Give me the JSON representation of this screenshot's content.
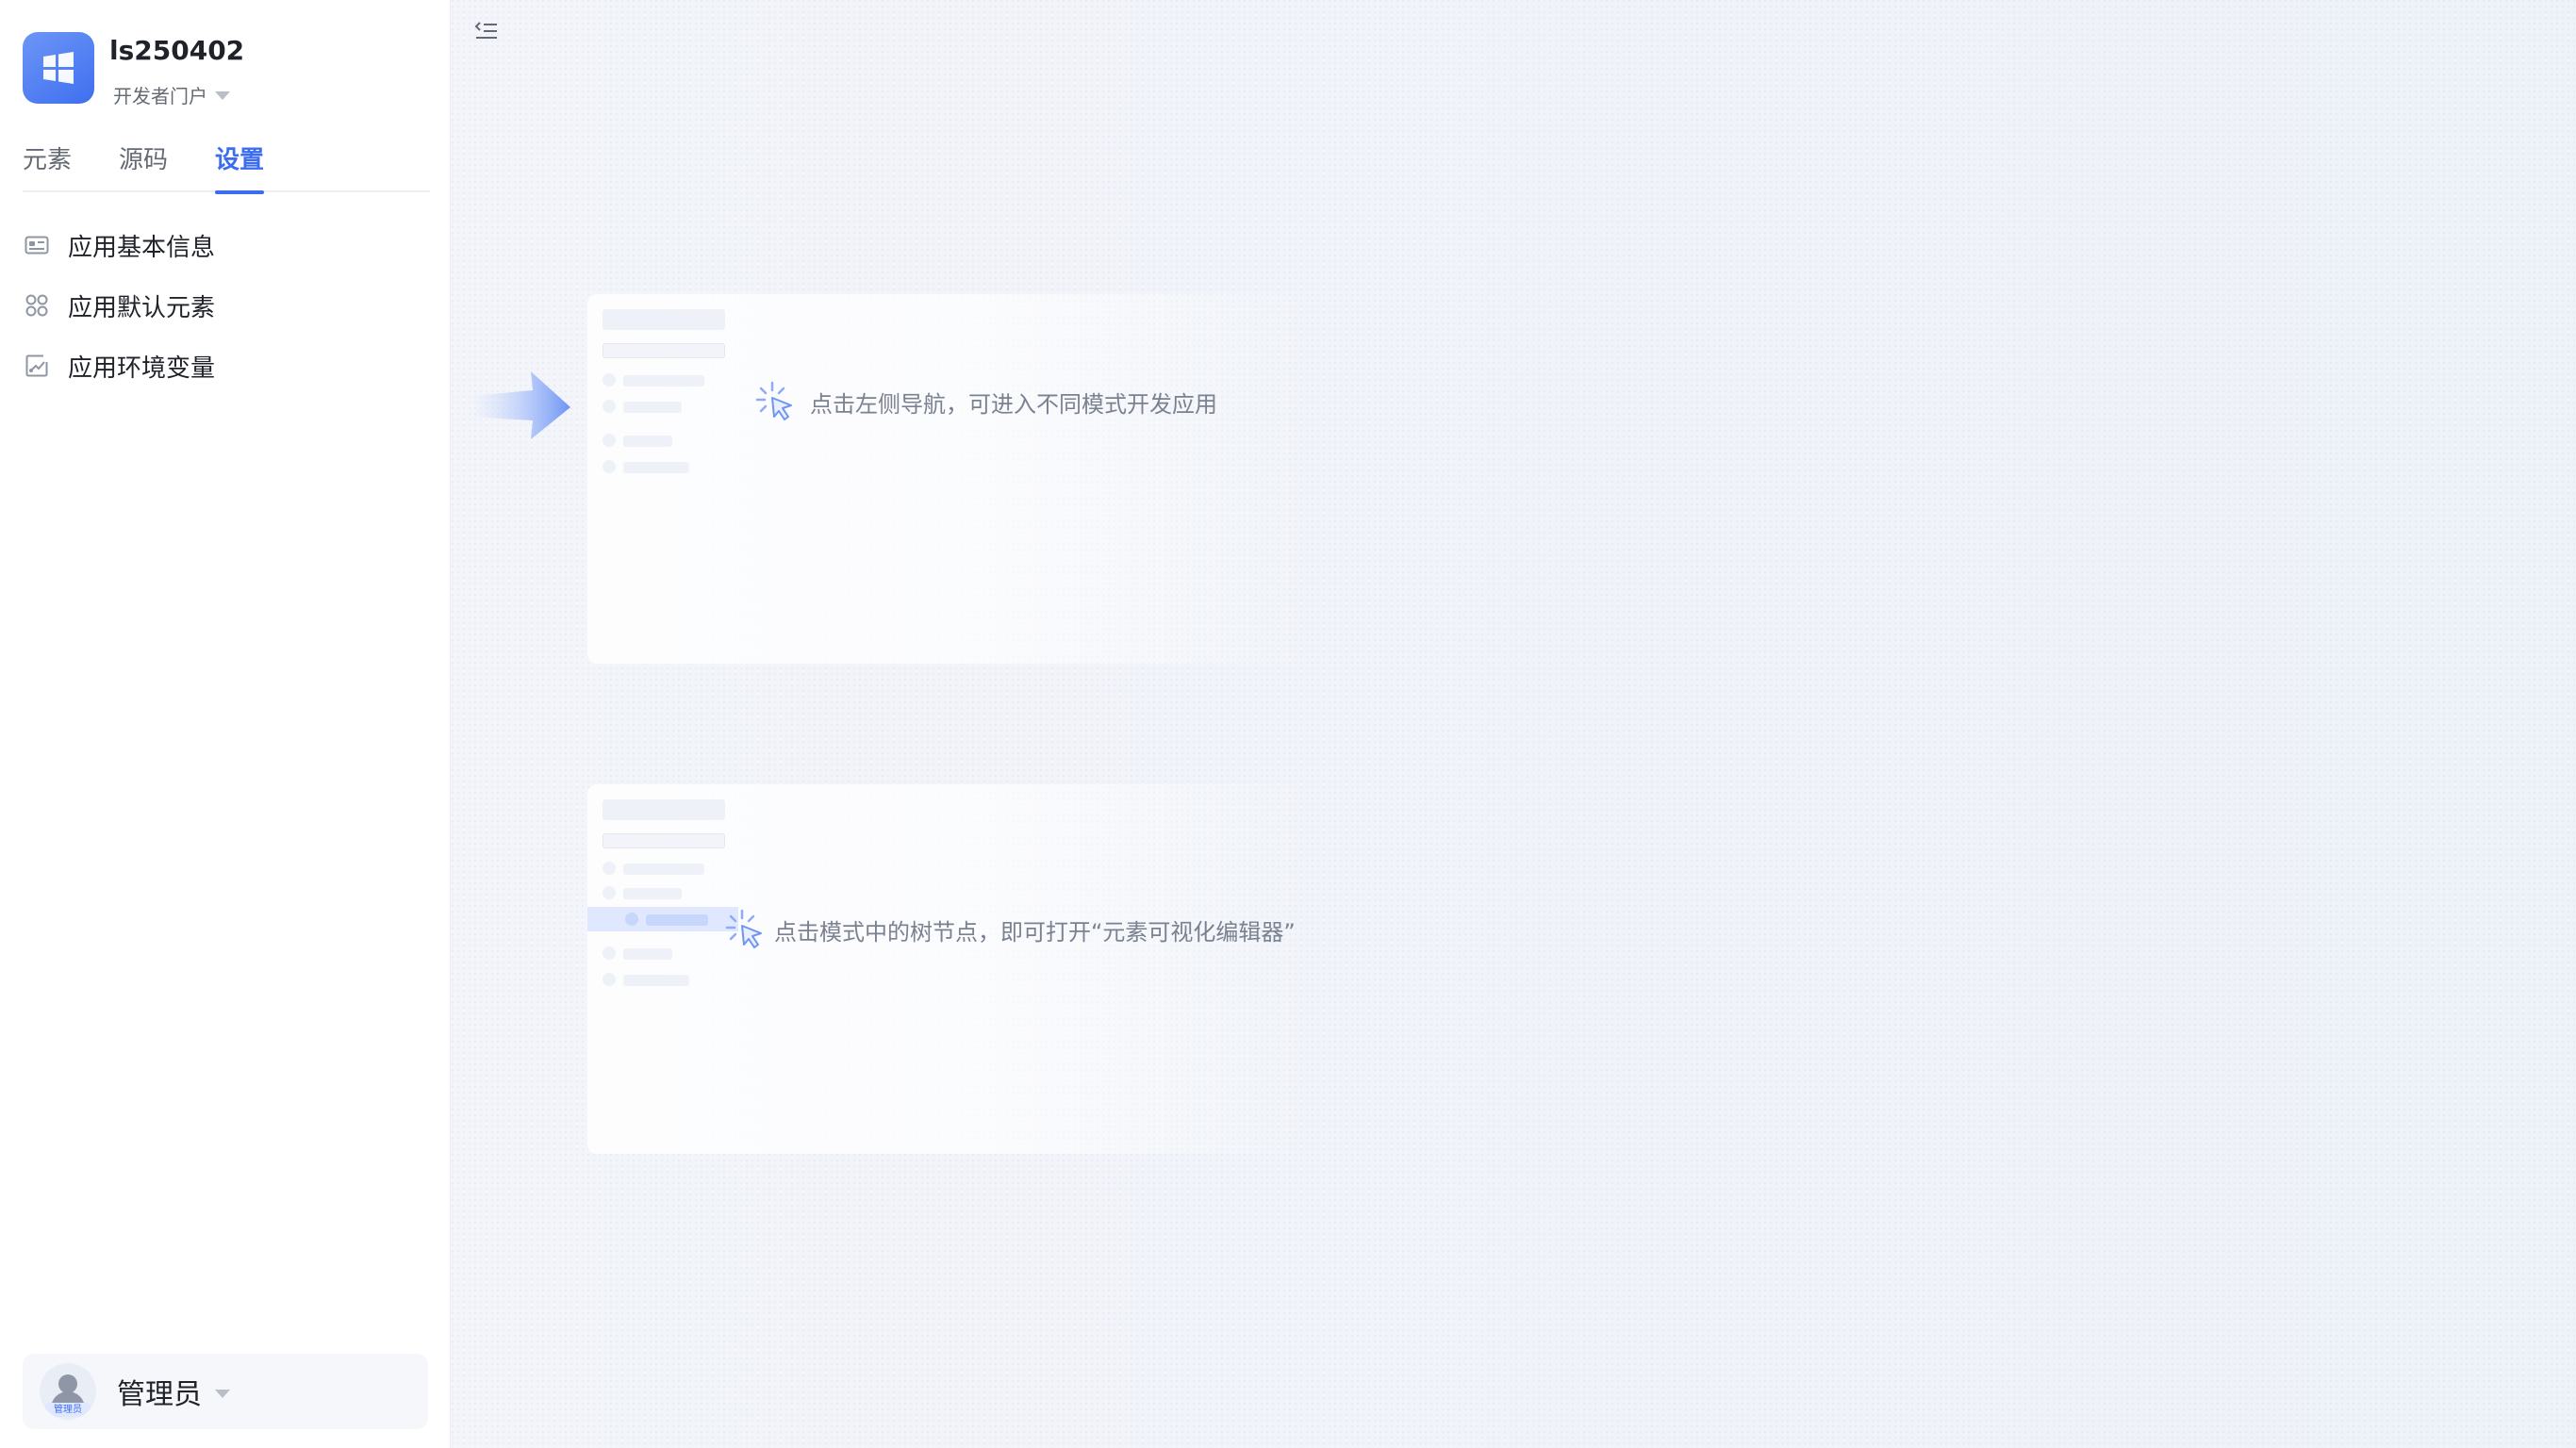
{
  "app": {
    "name": "ls250402",
    "portal": "开发者门户"
  },
  "tabs": [
    {
      "label": "元素",
      "active": false
    },
    {
      "label": "源码",
      "active": false
    },
    {
      "label": "设置",
      "active": true
    }
  ],
  "menu": [
    {
      "label": "应用基本信息",
      "icon": "id-card-icon"
    },
    {
      "label": "应用默认元素",
      "icon": "four-circles-icon"
    },
    {
      "label": "应用环境变量",
      "icon": "variable-icon"
    }
  ],
  "user": {
    "name": "管理员",
    "avatar_tag": "管理员"
  },
  "guides": [
    {
      "text": "点击左侧导航，可进入不同模式开发应用"
    },
    {
      "text": "点击模式中的树节点，即可打开“元素可视化编辑器”"
    }
  ],
  "colors": {
    "accent": "#3c6cf0",
    "logo": "#4f7ef3",
    "text": "#1f2329",
    "muted": "#7a8190"
  }
}
